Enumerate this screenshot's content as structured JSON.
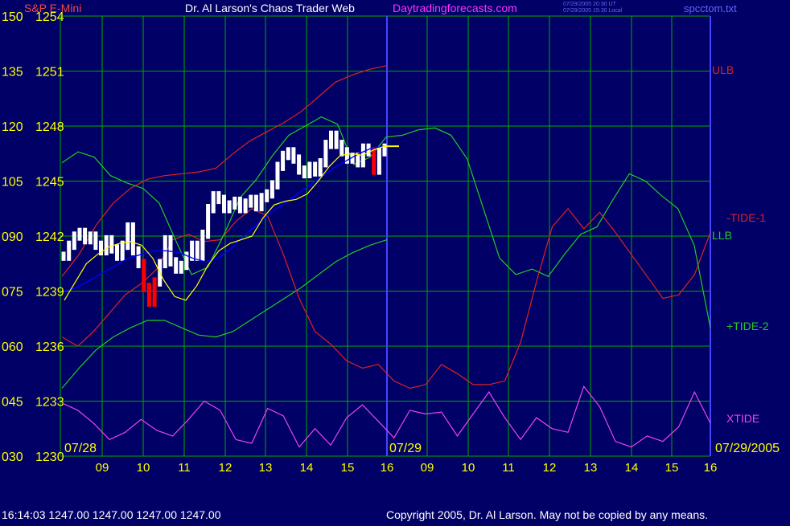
{
  "header": {
    "instrument": "S&P E-Mini",
    "title": "Dr. Al Larson's Chaos Trader Web",
    "site": "Daytradingforecasts.com",
    "timestamp_ut": "07/29/2005 20:30 UT",
    "timestamp_local": "07/29/2005 15:30 Local",
    "file": "spcctom.txt"
  },
  "footer": {
    "quote": "16:14:03  1247.00 1247.00 1247.00 1247.00",
    "copyright": "Copyright 2005, Dr. Al Larson. May not be copied by any means."
  },
  "colors": {
    "background": "#000066",
    "grid": "#00aa00",
    "axis_text": "#ffff00",
    "price_bar": "#ffffff",
    "price_bar_down": "#ff0000",
    "ulb": "#dd2222",
    "llb": "#22cc22",
    "tide_minus_1": "#dd2222",
    "tide_plus_2": "#22cc22",
    "xtide": "#ee44ee",
    "ma_blue": "#0000ff",
    "ma_yellow": "#ffff00",
    "divider": "#4444ff"
  },
  "chart_data": {
    "type": "line",
    "title": "Dr. Al Larson's Chaos Trader Web",
    "left_scale_labels": [
      "150",
      "135",
      "120",
      "105",
      "090",
      "075",
      "060",
      "045",
      "030"
    ],
    "price_scale_labels": [
      "1254",
      "1251",
      "1248",
      "1245",
      "1242",
      "1239",
      "1236",
      "1233",
      "1230"
    ],
    "price_range": [
      1230,
      1254
    ],
    "oscillator_range": [
      30,
      150
    ],
    "x_time_labels": [
      "09",
      "10",
      "11",
      "12",
      "13",
      "14",
      "15",
      "16",
      "09",
      "10",
      "11",
      "12",
      "13",
      "14",
      "15",
      "16"
    ],
    "date_labels": [
      "07/28",
      "07/29",
      "07/29/2005"
    ],
    "series_labels": {
      "ulb": "ULB",
      "tide_minus_1": "-TIDE-1",
      "llb": "LLB",
      "tide_plus_2": "+TIDE-2",
      "xtide": "XTIDE"
    },
    "price_bars_close": [
      1240.9,
      1241.5,
      1242,
      1242.2,
      1241.8,
      1242,
      1241.5,
      1241.2,
      1241.8,
      1241.3,
      1240.9,
      1241.5,
      1242.5,
      1241.2,
      1240.5,
      1239.2,
      1238.4,
      1239.5,
      1240.5,
      1241.8,
      1240.6,
      1240.2,
      1240.4,
      1240.9,
      1241.5,
      1240.9,
      1242.1,
      1243.5,
      1244.2,
      1244,
      1243.5,
      1243.7,
      1243.9,
      1243.5,
      1243.8,
      1244,
      1243.6,
      1244.1,
      1244.3,
      1244.8,
      1245.8,
      1246.4,
      1246.6,
      1246.2,
      1245.6,
      1245.4,
      1245.8,
      1245.5,
      1246,
      1247,
      1247.5,
      1247,
      1246.6,
      1246.2,
      1246.3,
      1246,
      1246.8,
      1246.6,
      1245.6,
      1246.6,
      1246.8
    ],
    "ma_blue": [
      1239,
      1239.2,
      1239.6,
      1240,
      1240.4,
      1240.8,
      1241,
      1241.2,
      1241.2,
      1241.1,
      1240.8,
      1240.6,
      1240.8,
      1241.3,
      1242,
      1242.6,
      1243.2,
      1243.7,
      1244.2,
      1244.7,
      1245.2,
      1245.7,
      1246.1,
      1246.5,
      1246.8,
      1246.9
    ],
    "ma_yellow": [
      1238.5,
      1239.5,
      1240.5,
      1241,
      1241.4,
      1241.6,
      1241.7,
      1241.5,
      1240.8,
      1239.6,
      1238.7,
      1238.5,
      1239.3,
      1240.4,
      1241.2,
      1241.6,
      1241.8,
      1242,
      1243,
      1243.7,
      1243.9,
      1244,
      1244.3,
      1245,
      1245.8,
      1246.4,
      1246.5,
      1246.4,
      1246.7,
      1246.9
    ],
    "ulb": [
      1239.8,
      1241,
      1242.6,
      1243.8,
      1244.6,
      1245.1,
      1245.3,
      1245.4,
      1245.5,
      1245.7,
      1246.5,
      1247.2,
      1247.7,
      1248.2,
      1248.8,
      1249.6,
      1250.4,
      1250.8,
      1251.1,
      1251.3
    ],
    "llb": [
      1233.7,
      1234.8,
      1235.8,
      1236.5,
      1237,
      1237.4,
      1237.4,
      1237,
      1236.6,
      1236.5,
      1236.8,
      1237.4,
      1238,
      1238.6,
      1239.2,
      1239.9,
      1240.6,
      1241.1,
      1241.5,
      1241.8
    ],
    "tide_minus_1": [
      1236.5,
      1236,
      1236.8,
      1237.8,
      1238.8,
      1239.4,
      1240.2,
      1241.8,
      1242.1,
      1241.7,
      1241.8,
      1242.8,
      1243.5,
      1243.1,
      1241,
      1238.6,
      1236.8,
      1236.1,
      1235.2,
      1234.8,
      1235,
      1234.1,
      1233.7,
      1233.9,
      1235,
      1234.5,
      1233.9,
      1233.9,
      1234.1,
      1236.2,
      1239.5,
      1242.5,
      1243.5,
      1242.4,
      1243.3,
      1242.2,
      1241,
      1239.8,
      1238.6,
      1238.8,
      1239.9,
      1242.2
    ],
    "tide_plus_2": [
      1246,
      1246.6,
      1246.3,
      1245.3,
      1244.9,
      1244.6,
      1243.8,
      1241.8,
      1239.9,
      1240.3,
      1242.1,
      1244.1,
      1245.1,
      1246.4,
      1247.5,
      1248,
      1248.5,
      1248.1,
      1245.9,
      1246.3,
      1247.4,
      1247.5,
      1247.8,
      1247.9,
      1247.5,
      1246.2,
      1243.5,
      1240.8,
      1239.9,
      1240.2,
      1239.8,
      1241,
      1242.1,
      1242.5,
      1244,
      1245.4,
      1245,
      1244.2,
      1243.5,
      1241.5,
      1237
    ],
    "xtide": [
      1232.9,
      1232.5,
      1231.8,
      1230.9,
      1231.3,
      1232,
      1231.4,
      1231.1,
      1232,
      1233,
      1232.5,
      1230.9,
      1230.7,
      1232.6,
      1232.2,
      1230.5,
      1231.5,
      1230.6,
      1232.1,
      1232.8,
      1231.9,
      1231,
      1232.5,
      1232.3,
      1232.4,
      1231.1,
      1232.3,
      1233.5,
      1232.1,
      1230.9,
      1232.1,
      1231.5,
      1231.3,
      1233.8,
      1232.7,
      1230.8,
      1230.5,
      1231.1,
      1230.8,
      1231.6,
      1233.5,
      1231.8
    ]
  }
}
